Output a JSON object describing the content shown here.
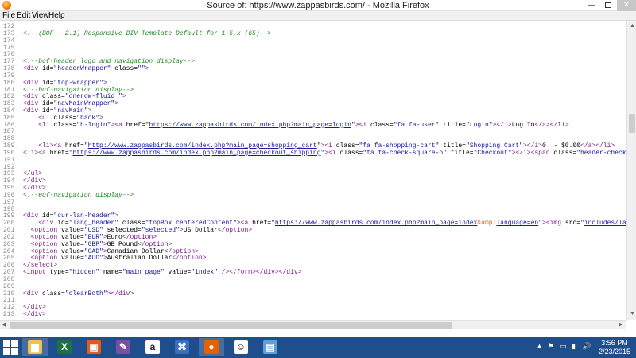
{
  "window": {
    "title": "Source of: https://www.zappasbirds.com/ - Mozilla Firefox",
    "minimize_glyph": "—",
    "close_glyph": "✕"
  },
  "menu": [
    "File",
    "Edit",
    "View",
    "Help"
  ],
  "source_lines": [
    {
      "n": "172",
      "parts": []
    },
    {
      "n": "173",
      "parts": [
        {
          "t": "<!--(BOF - 2.1) Responsive DIV Template Default for 1.5.x (65)-->",
          "c": "comment"
        }
      ]
    },
    {
      "n": "174",
      "parts": []
    },
    {
      "n": "175",
      "parts": []
    },
    {
      "n": "176",
      "parts": []
    },
    {
      "n": "177",
      "parts": [
        {
          "t": "<!--bof-header logo and navigation display-->",
          "c": "comment"
        }
      ]
    },
    {
      "n": "178",
      "parts": [
        {
          "t": "<div ",
          "c": "tag"
        },
        {
          "t": "id=",
          "c": "attr"
        },
        {
          "t": "\"headerWrapper\"",
          "c": "val"
        },
        {
          "t": " class=",
          "c": "attr"
        },
        {
          "t": "\"\"",
          "c": "val"
        },
        {
          "t": ">",
          "c": "tag"
        }
      ]
    },
    {
      "n": "179",
      "parts": []
    },
    {
      "n": "180",
      "parts": [
        {
          "t": "<div ",
          "c": "tag"
        },
        {
          "t": "id=",
          "c": "attr"
        },
        {
          "t": "\"top-wrapper\"",
          "c": "val"
        },
        {
          "t": ">",
          "c": "tag"
        }
      ]
    },
    {
      "n": "181",
      "parts": [
        {
          "t": "<!--bof-navigation display-->",
          "c": "comment"
        }
      ]
    },
    {
      "n": "182",
      "parts": [
        {
          "t": "<div ",
          "c": "tag"
        },
        {
          "t": "class=",
          "c": "attr"
        },
        {
          "t": "\"onerow-fluid \"",
          "c": "val"
        },
        {
          "t": ">",
          "c": "tag"
        }
      ]
    },
    {
      "n": "183",
      "parts": [
        {
          "t": "<div ",
          "c": "tag"
        },
        {
          "t": "id=",
          "c": "attr"
        },
        {
          "t": "\"navMainWrapper\"",
          "c": "val"
        },
        {
          "t": ">",
          "c": "tag"
        }
      ]
    },
    {
      "n": "184",
      "parts": [
        {
          "t": "<div ",
          "c": "tag"
        },
        {
          "t": "id=",
          "c": "attr"
        },
        {
          "t": "\"navMain\"",
          "c": "val"
        },
        {
          "t": ">",
          "c": "tag"
        }
      ]
    },
    {
      "n": "185",
      "parts": [
        {
          "t": "    <ul ",
          "c": "tag"
        },
        {
          "t": "class=",
          "c": "attr"
        },
        {
          "t": "\"back\"",
          "c": "val"
        },
        {
          "t": ">",
          "c": "tag"
        }
      ]
    },
    {
      "n": "186",
      "parts": [
        {
          "t": "    <li ",
          "c": "tag"
        },
        {
          "t": "class=",
          "c": "attr"
        },
        {
          "t": "\"h-login\"",
          "c": "val"
        },
        {
          "t": "><a ",
          "c": "tag"
        },
        {
          "t": "href=",
          "c": "attr"
        },
        {
          "t": "\"",
          "c": "val"
        },
        {
          "t": "https://www.zappasbirds.com/index.php?main_page=login",
          "c": "link"
        },
        {
          "t": "\"",
          "c": "val"
        },
        {
          "t": "><i ",
          "c": "tag"
        },
        {
          "t": "class=",
          "c": "attr"
        },
        {
          "t": "\"fa fa-user\"",
          "c": "val"
        },
        {
          "t": " title=",
          "c": "attr"
        },
        {
          "t": "\"Login\"",
          "c": "val"
        },
        {
          "t": "></i>",
          "c": "tag"
        },
        {
          "t": "Log In",
          "c": "attr"
        },
        {
          "t": "</a></li>",
          "c": "tag"
        }
      ]
    },
    {
      "n": "187",
      "parts": []
    },
    {
      "n": "188",
      "parts": []
    },
    {
      "n": "189",
      "parts": [
        {
          "t": "    <li><a ",
          "c": "tag"
        },
        {
          "t": "href=",
          "c": "attr"
        },
        {
          "t": "\"",
          "c": "val"
        },
        {
          "t": "http://www.zappasbirds.com/index.php?main_page=shopping_cart",
          "c": "link"
        },
        {
          "t": "\"",
          "c": "val"
        },
        {
          "t": "><i ",
          "c": "tag"
        },
        {
          "t": "class=",
          "c": "attr"
        },
        {
          "t": "\"fa fa-shopping-cart\"",
          "c": "val"
        },
        {
          "t": " title=",
          "c": "attr"
        },
        {
          "t": "\"Shopping Cart\"",
          "c": "val"
        },
        {
          "t": "></i>",
          "c": "tag"
        },
        {
          "t": "0  - $0.00",
          "c": "attr"
        },
        {
          "t": "</a></li>",
          "c": "tag"
        }
      ]
    },
    {
      "n": "190",
      "parts": [
        {
          "t": "<li><a ",
          "c": "tag"
        },
        {
          "t": "href=",
          "c": "attr"
        },
        {
          "t": "\"",
          "c": "val"
        },
        {
          "t": "https://www.zappasbirds.com/index.php?main_page=checkout_shipping",
          "c": "link"
        },
        {
          "t": "\"",
          "c": "val"
        },
        {
          "t": "><i ",
          "c": "tag"
        },
        {
          "t": "class=",
          "c": "attr"
        },
        {
          "t": "\"fa fa-check-square-o\"",
          "c": "val"
        },
        {
          "t": " title=",
          "c": "attr"
        },
        {
          "t": "\"Checkout\"",
          "c": "val"
        },
        {
          "t": "></i><span ",
          "c": "tag"
        },
        {
          "t": "class=",
          "c": "attr"
        },
        {
          "t": "\"header-checkout\"",
          "c": "val"
        }
      ]
    },
    {
      "n": "191",
      "parts": []
    },
    {
      "n": "192",
      "parts": []
    },
    {
      "n": "193",
      "parts": [
        {
          "t": "</ul>",
          "c": "tag"
        }
      ]
    },
    {
      "n": "194",
      "parts": [
        {
          "t": "</div>",
          "c": "tag"
        }
      ]
    },
    {
      "n": "195",
      "parts": [
        {
          "t": "</div>",
          "c": "tag"
        }
      ]
    },
    {
      "n": "196",
      "parts": [
        {
          "t": "<!--eof-navigation display-->",
          "c": "comment"
        }
      ]
    },
    {
      "n": "197",
      "parts": []
    },
    {
      "n": "198",
      "parts": []
    },
    {
      "n": "199",
      "parts": [
        {
          "t": "<div ",
          "c": "tag"
        },
        {
          "t": "id=",
          "c": "attr"
        },
        {
          "t": "\"cur-lan-header\"",
          "c": "val"
        },
        {
          "t": ">",
          "c": "tag"
        }
      ]
    },
    {
      "n": "200",
      "parts": [
        {
          "t": "    <div ",
          "c": "tag"
        },
        {
          "t": "id=",
          "c": "attr"
        },
        {
          "t": "\"lang_header\"",
          "c": "val"
        },
        {
          "t": " class=",
          "c": "attr"
        },
        {
          "t": "\"topBox centeredContent\"",
          "c": "val"
        },
        {
          "t": "><a ",
          "c": "tag"
        },
        {
          "t": "href=",
          "c": "attr"
        },
        {
          "t": "\"",
          "c": "val"
        },
        {
          "t": "https://www.zappasbirds.com/index.php?main_page=index",
          "c": "link"
        },
        {
          "t": "&amp;",
          "c": "ent"
        },
        {
          "t": "language=en",
          "c": "link"
        },
        {
          "t": "\"",
          "c": "val"
        },
        {
          "t": "><img ",
          "c": "tag"
        },
        {
          "t": "src=",
          "c": "attr"
        },
        {
          "t": "\"",
          "c": "val"
        },
        {
          "t": "includes/languag",
          "c": "link"
        }
      ]
    },
    {
      "n": "201",
      "parts": [
        {
          "t": "  <option ",
          "c": "tag"
        },
        {
          "t": "value=",
          "c": "attr"
        },
        {
          "t": "\"USD\"",
          "c": "val"
        },
        {
          "t": " selected=",
          "c": "attr"
        },
        {
          "t": "\"selected\"",
          "c": "val"
        },
        {
          "t": ">",
          "c": "tag"
        },
        {
          "t": "US Dollar",
          "c": "attr"
        },
        {
          "t": "</option>",
          "c": "tag"
        }
      ]
    },
    {
      "n": "202",
      "parts": [
        {
          "t": "  <option ",
          "c": "tag"
        },
        {
          "t": "value=",
          "c": "attr"
        },
        {
          "t": "\"EUR\"",
          "c": "val"
        },
        {
          "t": ">",
          "c": "tag"
        },
        {
          "t": "Euro",
          "c": "attr"
        },
        {
          "t": "</option>",
          "c": "tag"
        }
      ]
    },
    {
      "n": "203",
      "parts": [
        {
          "t": "  <option ",
          "c": "tag"
        },
        {
          "t": "value=",
          "c": "attr"
        },
        {
          "t": "\"GBP\"",
          "c": "val"
        },
        {
          "t": ">",
          "c": "tag"
        },
        {
          "t": "GB Pound",
          "c": "attr"
        },
        {
          "t": "</option>",
          "c": "tag"
        }
      ]
    },
    {
      "n": "204",
      "parts": [
        {
          "t": "  <option ",
          "c": "tag"
        },
        {
          "t": "value=",
          "c": "attr"
        },
        {
          "t": "\"CAD\"",
          "c": "val"
        },
        {
          "t": ">",
          "c": "tag"
        },
        {
          "t": "Canadian Dollar",
          "c": "attr"
        },
        {
          "t": "</option>",
          "c": "tag"
        }
      ]
    },
    {
      "n": "205",
      "parts": [
        {
          "t": "  <option ",
          "c": "tag"
        },
        {
          "t": "value=",
          "c": "attr"
        },
        {
          "t": "\"AUD\"",
          "c": "val"
        },
        {
          "t": ">",
          "c": "tag"
        },
        {
          "t": "Australian Dollar",
          "c": "attr"
        },
        {
          "t": "</option>",
          "c": "tag"
        }
      ]
    },
    {
      "n": "206",
      "parts": [
        {
          "t": "</select>",
          "c": "tag"
        }
      ]
    },
    {
      "n": "207",
      "parts": [
        {
          "t": "<input ",
          "c": "tag"
        },
        {
          "t": "type=",
          "c": "attr"
        },
        {
          "t": "\"hidden\"",
          "c": "val"
        },
        {
          "t": " name=",
          "c": "attr"
        },
        {
          "t": "\"main_page\"",
          "c": "val"
        },
        {
          "t": " value=",
          "c": "attr"
        },
        {
          "t": "\"index\"",
          "c": "val"
        },
        {
          "t": " /></form></div></div>",
          "c": "tag"
        }
      ]
    },
    {
      "n": "208",
      "parts": []
    },
    {
      "n": "209",
      "parts": []
    },
    {
      "n": "210",
      "parts": [
        {
          "t": "<div ",
          "c": "tag"
        },
        {
          "t": "class=",
          "c": "attr"
        },
        {
          "t": "\"clearBoth\"",
          "c": "val"
        },
        {
          "t": "></div>",
          "c": "tag"
        }
      ]
    },
    {
      "n": "211",
      "parts": []
    },
    {
      "n": "212",
      "parts": [
        {
          "t": "</div>",
          "c": "tag"
        }
      ]
    },
    {
      "n": "213",
      "parts": [
        {
          "t": "</div>",
          "c": "tag"
        }
      ]
    }
  ],
  "scrollbar": {
    "up": "▲",
    "down": "▼",
    "left": "◀",
    "right": "▶"
  },
  "taskbar": {
    "apps": [
      {
        "name": "file-explorer",
        "icon": "folder-icon",
        "color": "#f2c14e",
        "glyph": "▆",
        "active": true
      },
      {
        "name": "excel",
        "icon": "spreadsheet-icon",
        "color": "#1e7145",
        "glyph": "X",
        "active": false
      },
      {
        "name": "office",
        "icon": "office-icon",
        "color": "#e25b1c",
        "glyph": "▣",
        "active": false
      },
      {
        "name": "paint",
        "icon": "paint-icon",
        "color": "#7a4fa1",
        "glyph": "✎",
        "active": false
      },
      {
        "name": "amazon",
        "icon": "amazon-icon",
        "color": "#ffffff",
        "glyph": "a",
        "active": false
      },
      {
        "name": "network",
        "icon": "network-icon",
        "color": "#3a6fc0",
        "glyph": "⌘",
        "active": false
      },
      {
        "name": "firefox",
        "icon": "firefox-icon",
        "color": "#e66000",
        "glyph": "●",
        "active": true
      },
      {
        "name": "game",
        "icon": "cartoon-icon",
        "color": "#ffffff",
        "glyph": "☺",
        "active": false
      },
      {
        "name": "notes",
        "icon": "notepad-icon",
        "color": "#5da2d5",
        "glyph": "▤",
        "active": false
      }
    ],
    "time": "3:56 PM",
    "date": "2/23/2015",
    "tray": [
      "▲",
      "⚑",
      "▭",
      "▮",
      "🔊"
    ]
  }
}
